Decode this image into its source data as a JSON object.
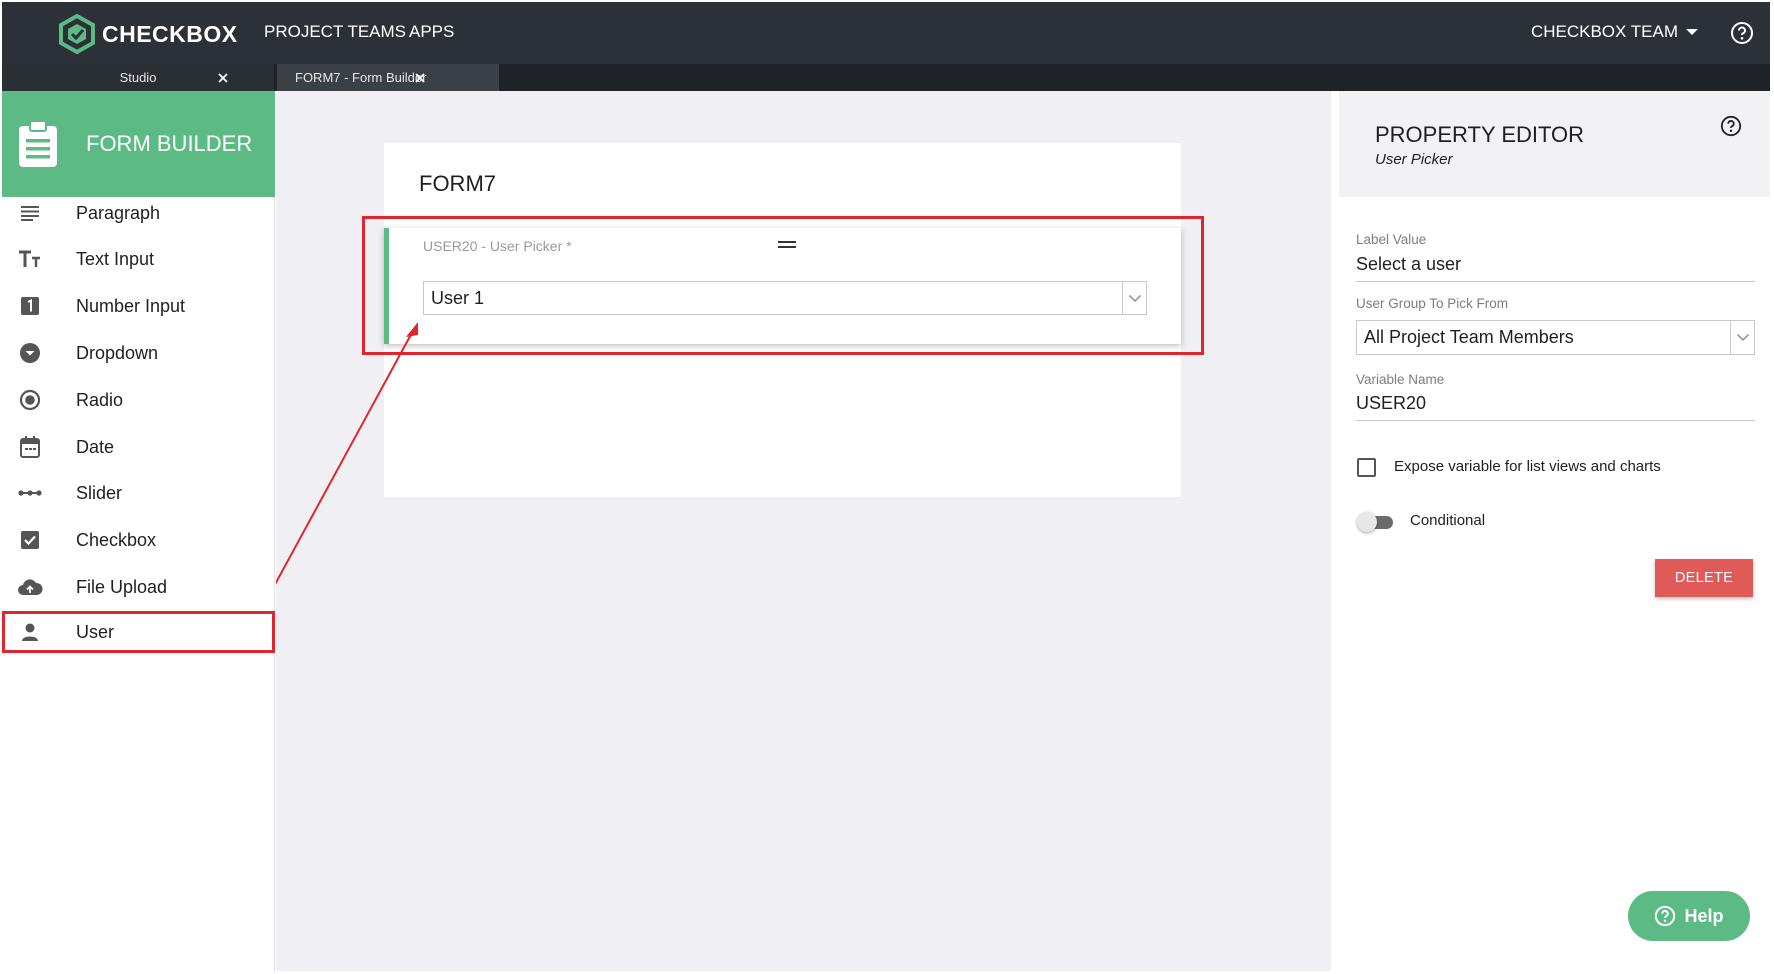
{
  "topbar": {
    "brand": "CHECKBOX",
    "nav": [
      "PROJECT TEAMS",
      "APPS"
    ],
    "team_menu": "CHECKBOX TEAM"
  },
  "tabs": [
    {
      "label": "Studio"
    },
    {
      "label": "FORM7 - Form Builder"
    }
  ],
  "sidebar": {
    "title": "FORM BUILDER",
    "items": [
      {
        "label": "Paragraph",
        "icon": "paragraph-icon"
      },
      {
        "label": "Text Input",
        "icon": "text-input-icon"
      },
      {
        "label": "Number Input",
        "icon": "number-input-icon"
      },
      {
        "label": "Dropdown",
        "icon": "dropdown-icon"
      },
      {
        "label": "Radio",
        "icon": "radio-icon"
      },
      {
        "label": "Date",
        "icon": "calendar-icon"
      },
      {
        "label": "Slider",
        "icon": "slider-icon"
      },
      {
        "label": "Checkbox",
        "icon": "checkbox-icon"
      },
      {
        "label": "File Upload",
        "icon": "cloud-upload-icon"
      },
      {
        "label": "User",
        "icon": "user-icon",
        "selected": true
      }
    ]
  },
  "form": {
    "title": "FORM7",
    "field": {
      "label": "USER20 - User Picker *",
      "value": "User 1"
    }
  },
  "property_editor": {
    "title": "PROPERTY EDITOR",
    "subtitle": "User Picker",
    "label_value_label": "Label Value",
    "label_value": "Select a user",
    "user_group_label": "User Group To Pick From",
    "user_group_value": "All Project Team Members",
    "variable_name_label": "Variable Name",
    "variable_name": "USER20",
    "expose_label": "Expose variable for list views and charts",
    "expose_checked": false,
    "conditional_label": "Conditional",
    "conditional_on": false,
    "delete_label": "DELETE"
  },
  "help_button": "Help",
  "colors": {
    "topbar": "#2c3138",
    "accent_green": "#5cbb85",
    "highlight_red": "#e0252c",
    "delete_red": "#e05a5a"
  }
}
